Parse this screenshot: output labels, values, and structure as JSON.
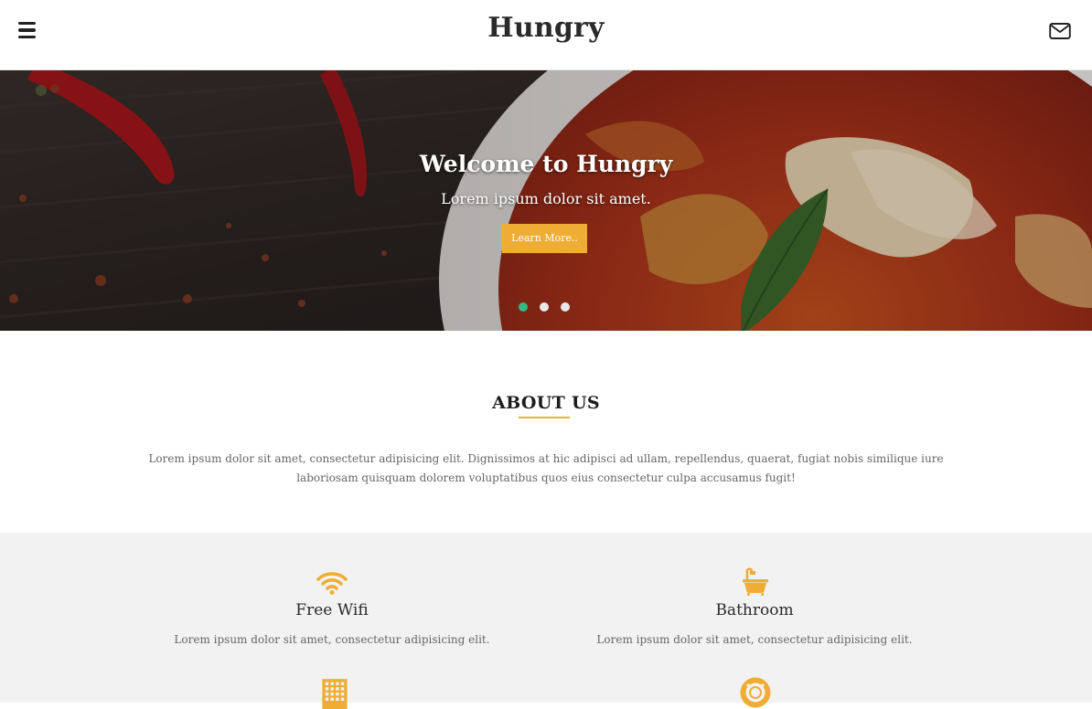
{
  "navbar": {
    "brand": "Hungry",
    "menu_icon": "hamburger-menu-icon",
    "mail_icon": "envelope-icon"
  },
  "hero": {
    "title": "Welcome to Hungry",
    "subtitle": "Lorem ipsum dolor sit amet.",
    "button_label": "Learn More..",
    "slides": 3,
    "active_slide": 1
  },
  "about": {
    "title": "ABOUT US",
    "text": "Lorem ipsum dolor sit amet, consectetur adipisicing elit. Dignissimos at hic adipisci ad ullam, repellendus, quaerat, fugiat nobis similique iure laboriosam quisquam dolorem voluptatibus quos eius consectetur culpa accusamus fugit!"
  },
  "features": [
    {
      "icon": "wifi-icon",
      "title": "Free Wifi",
      "desc": "Lorem ipsum dolor sit amet, consectetur adipisicing elit."
    },
    {
      "icon": "bathtub-icon",
      "title": "Bathroom",
      "desc": "Lorem ipsum dolor sit amet, consectetur adipisicing elit."
    },
    {
      "icon": "building-icon",
      "title": "",
      "desc": ""
    },
    {
      "icon": "life-ring-icon",
      "title": "",
      "desc": ""
    }
  ],
  "colors": {
    "accent": "#f0ad35",
    "active_dot": "#2dbb88",
    "features_bg": "#f2f2f2"
  }
}
